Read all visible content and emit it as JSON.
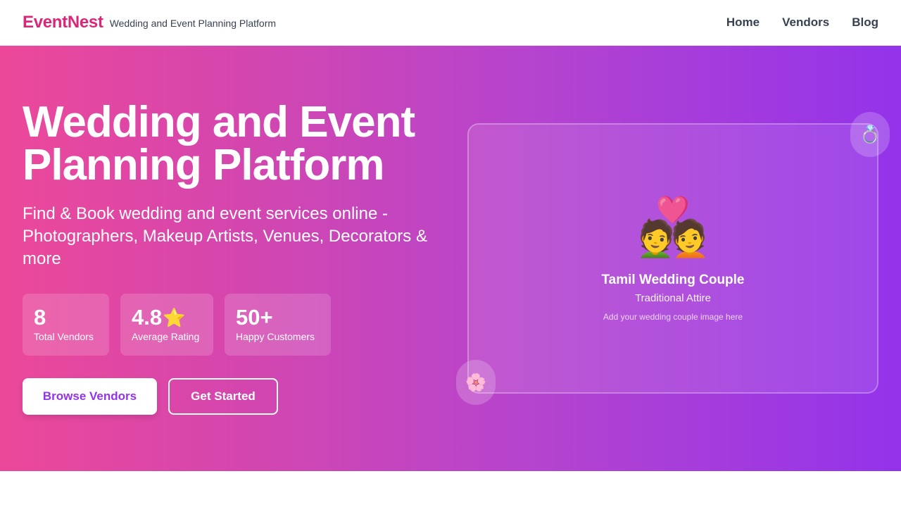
{
  "header": {
    "logo": "EventNest",
    "tagline": "Wedding and Event Planning Platform",
    "nav": [
      "Home",
      "Vendors",
      "Blog"
    ]
  },
  "hero": {
    "title": "Wedding and Event Planning Platform",
    "subtitle": "Find & Book wedding and event services online - Photographers, Makeup Artists, Venues, Decorators & more",
    "stats": [
      {
        "value": "8",
        "label": "Total Vendors"
      },
      {
        "value": "4.8",
        "icon": "star-icon",
        "icon_glyph": "⭐",
        "label": "Average Rating"
      },
      {
        "value": "50+",
        "label": "Happy Customers"
      }
    ],
    "buttons": {
      "browse": "Browse Vendors",
      "start": "Get Started"
    }
  },
  "card": {
    "icon": "couple-with-heart-icon",
    "icon_glyph": "💑",
    "title": "Tamil Wedding Couple",
    "subtitle": "Traditional Attire",
    "hint": "Add your wedding couple image here"
  },
  "decorations": {
    "ring": {
      "icon": "ring-icon",
      "glyph": "💍"
    },
    "flower": {
      "icon": "flower-icon",
      "glyph": "🌸"
    }
  },
  "colors": {
    "brand": "#db2777",
    "gradient_start": "#ec4899",
    "gradient_end": "#9333ea",
    "button_text": "#9333ea"
  }
}
